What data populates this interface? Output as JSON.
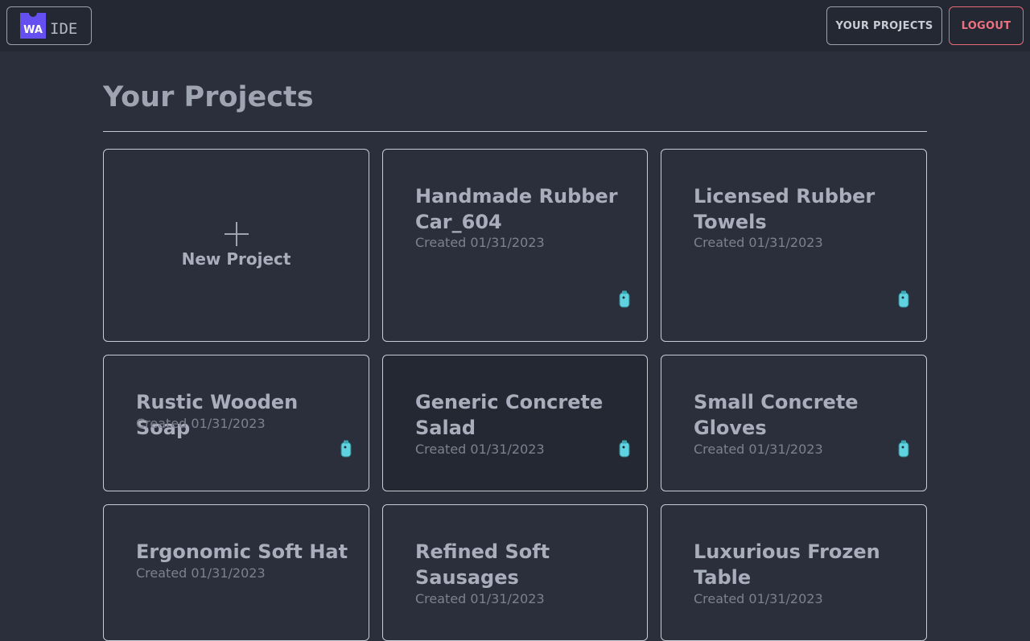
{
  "header": {
    "logo_mark": "WA",
    "logo_text": "IDE",
    "your_projects_label": "YOUR PROJECTS",
    "logout_label": "LOGOUT"
  },
  "main": {
    "title": "Your Projects",
    "new_project_label": "New Project",
    "projects": [
      {
        "name": "Handmade Rubber Car_604",
        "created": "Created 01/31/2023",
        "icon": "wasm-bottle-icon"
      },
      {
        "name": "Licensed Rubber Towels",
        "created": "Created 01/31/2023",
        "icon": "wasm-bottle-icon"
      },
      {
        "name": "Rustic Wooden Soap",
        "created": "Created 01/31/2023",
        "icon": "wasm-bottle-icon"
      },
      {
        "name": "Generic Concrete Salad",
        "created": "Created 01/31/2023",
        "icon": "wasm-bottle-icon"
      },
      {
        "name": "Small Concrete Gloves",
        "created": "Created 01/31/2023",
        "icon": "wasm-bottle-icon"
      },
      {
        "name": "Ergonomic Soft Hat",
        "created": "Created 01/31/2023",
        "icon": "wasm-bottle-icon"
      },
      {
        "name": "Refined Soft Sausages",
        "created": "Created 01/31/2023",
        "icon": "wasm-bottle-icon"
      },
      {
        "name": "Luxurious Frozen Table",
        "created": "Created 01/31/2023",
        "icon": "wasm-bottle-icon"
      }
    ]
  },
  "colors": {
    "background": "#2a2f3b",
    "topbar": "#242833",
    "brand": "#654ff0",
    "logout": "#ef7080",
    "icon_accent": "#5fd3e0"
  }
}
